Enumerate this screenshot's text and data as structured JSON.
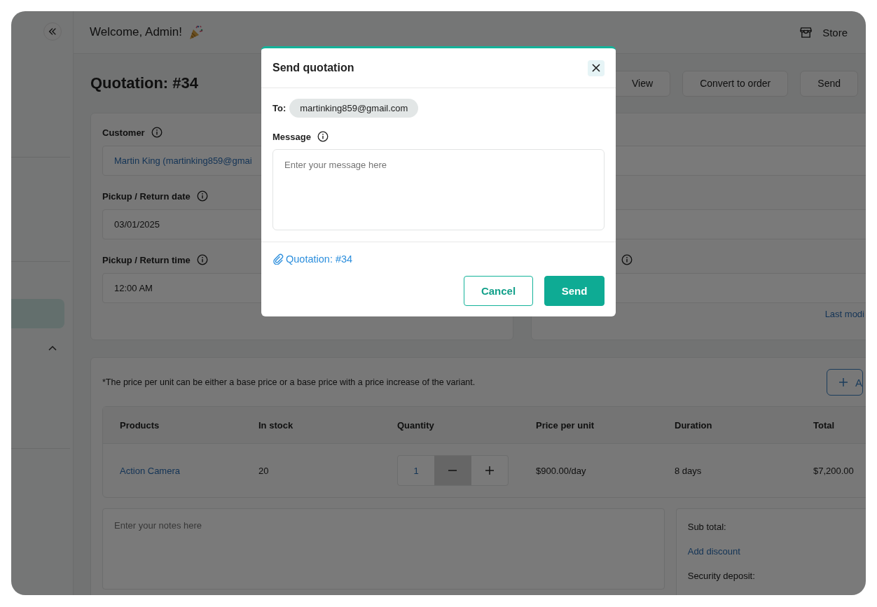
{
  "header": {
    "welcome": "Welcome, Admin!",
    "store": "Store"
  },
  "page": {
    "title": "Quotation: #34",
    "actions": [
      "View",
      "Convert to order",
      "Send"
    ]
  },
  "details_left": {
    "fields": [
      {
        "label": "Customer",
        "value": "Martin King (martinking859@gmai",
        "kind": "link"
      },
      {
        "label": "Pickup / Return date",
        "value": "03/01/2025",
        "kind": "text"
      },
      {
        "label": "Pickup / Return time",
        "value": "12:00 AM",
        "kind": "text"
      }
    ]
  },
  "details_right": {
    "fields": [
      {
        "info": false
      },
      {
        "info": false
      },
      {
        "info": true
      }
    ],
    "footer_link": "Last modi"
  },
  "products": {
    "note": "*The price per unit can be either a base price or a base price with a price increase of the variant.",
    "add_button": "A",
    "columns": [
      "Products",
      "In stock",
      "Quantity",
      "Price per unit",
      "Duration",
      "Total"
    ],
    "rows": [
      {
        "product": "Action Camera",
        "in_stock": "20",
        "quantity": "1",
        "price": "$900.00/day",
        "duration": "8 days",
        "total": "$7,200.00"
      }
    ],
    "notes_placeholder": "Enter your notes here",
    "summary": {
      "sub_total": "Sub total:",
      "add_discount": "Add discount",
      "security_deposit": "Security deposit:"
    }
  },
  "modal": {
    "title": "Send quotation",
    "to_label": "To:",
    "recipient": "martinking859@gmail.com",
    "message_label": "Message",
    "message_placeholder": "Enter your message here",
    "attachment": "Quotation: #34",
    "buttons": [
      {
        "label": "Cancel",
        "kind": "secondary"
      },
      {
        "label": "Send",
        "kind": "primary"
      }
    ]
  }
}
